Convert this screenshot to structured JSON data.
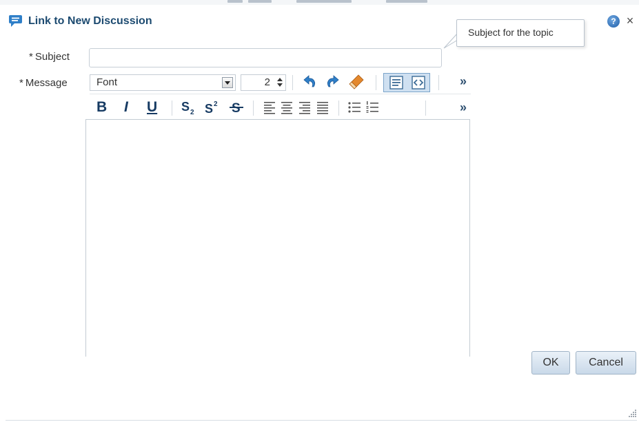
{
  "dialog": {
    "title": "Link to New Discussion",
    "help_label": "?",
    "close_label": "×"
  },
  "tooltip": {
    "text": "Subject for the topic"
  },
  "form": {
    "subject": {
      "required_marker": "*",
      "label": "Subject",
      "value": ""
    },
    "message": {
      "required_marker": "*",
      "label": "Message",
      "value": ""
    }
  },
  "toolbar": {
    "font_value": "Font",
    "size_value": "2",
    "more_label": "»",
    "format": {
      "bold": "B",
      "italic": "I",
      "underline": "U"
    }
  },
  "buttons": {
    "ok": "OK",
    "cancel": "Cancel"
  },
  "colors": {
    "title": "#1c4a70",
    "toolbar_icon": "#173b63",
    "button_gradient_top": "#eaf1f8",
    "button_gradient_bottom": "#c9d9e9",
    "active_toggle": "#cfe0f1"
  },
  "icons": {
    "title": "discussion-bubbles-icon",
    "undo": "undo-icon",
    "redo": "redo-icon",
    "clear_format": "eraser-icon",
    "rich_text_mode": "rich-text-mode-icon",
    "source_mode": "source-code-mode-icon"
  }
}
